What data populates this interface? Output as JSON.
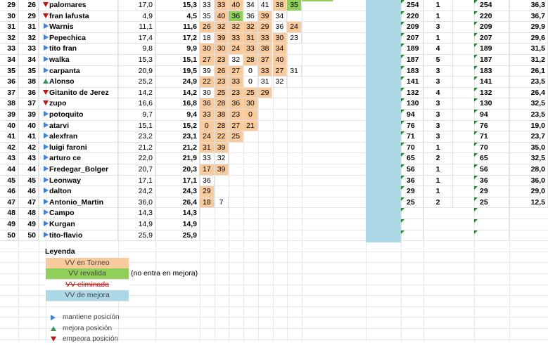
{
  "rows": [
    {
      "a": "29",
      "b": "26",
      "ind": "down",
      "name": "palomares",
      "e": "17,0",
      "f": "15,3",
      "scores": [
        "33",
        "33",
        "40",
        "34",
        "41",
        "38",
        "35"
      ],
      "score_fill": [
        "w",
        "p",
        "p",
        "w",
        "w",
        "p",
        "g"
      ],
      "rank": "254",
      "games": "1",
      "pts": "254",
      "avg": "36,3"
    },
    {
      "a": "30",
      "b": "29",
      "ind": "down",
      "name": "fran lafusta",
      "e": "4,9",
      "f": "4,5",
      "scores": [
        "35",
        "40",
        "36",
        "36",
        "39",
        "34"
      ],
      "score_fill": [
        "w",
        "p",
        "g",
        "w",
        "p",
        "w"
      ],
      "rank": "220",
      "games": "1",
      "pts": "220",
      "avg": "36,7"
    },
    {
      "a": "31",
      "b": "31",
      "ind": "right",
      "name": "Warnis",
      "e": "11,1",
      "f": "11,6",
      "scores": [
        "26",
        "32",
        "32",
        "32",
        "29",
        "36",
        "24"
      ],
      "score_fill": [
        "p",
        "p",
        "p",
        "p",
        "p",
        "w",
        "p"
      ],
      "rank": "209",
      "games": "3",
      "pts": "209",
      "avg": "29,9"
    },
    {
      "a": "32",
      "b": "32",
      "ind": "right",
      "name": "Pepechica",
      "e": "17,4",
      "f": "17,2",
      "scores": [
        "18",
        "39",
        "33",
        "31",
        "33",
        "30",
        "23"
      ],
      "score_fill": [
        "w",
        "p",
        "p",
        "p",
        "p",
        "p",
        "w"
      ],
      "rank": "207",
      "games": "1",
      "pts": "207",
      "avg": "29,6"
    },
    {
      "a": "33",
      "b": "33",
      "ind": "right",
      "name": "tito fran",
      "e": "9,8",
      "f": "9,9",
      "scores": [
        "30",
        "30",
        "24",
        "33",
        "38",
        "34"
      ],
      "score_fill": [
        "p",
        "p",
        "p",
        "p",
        "p",
        "p"
      ],
      "rank": "189",
      "games": "4",
      "pts": "189",
      "avg": "31,5"
    },
    {
      "a": "34",
      "b": "34",
      "ind": "right",
      "name": "walka",
      "e": "15,3",
      "f": "15,1",
      "scores": [
        "27",
        "23",
        "32",
        "28",
        "37",
        "40"
      ],
      "score_fill": [
        "p",
        "p",
        "w",
        "p",
        "p",
        "p"
      ],
      "rank": "187",
      "games": "5",
      "pts": "187",
      "avg": "31,2"
    },
    {
      "a": "35",
      "b": "35",
      "ind": "right",
      "name": "carpanta",
      "e": "20,9",
      "f": "19,5",
      "scores": [
        "39",
        "26",
        "27",
        "0",
        "33",
        "27",
        "31"
      ],
      "score_fill": [
        "w",
        "p",
        "p",
        "w",
        "p",
        "p",
        "w"
      ],
      "rank": "183",
      "games": "3",
      "pts": "183",
      "avg": "26,1"
    },
    {
      "a": "36",
      "b": "38",
      "ind": "up",
      "name": "Alonso",
      "e": "25,2",
      "f": "24,9",
      "scores": [
        "22",
        "23",
        "33",
        "0",
        "31",
        "32"
      ],
      "score_fill": [
        "p",
        "p",
        "p",
        "w",
        "w",
        "w"
      ],
      "rank": "141",
      "games": "3",
      "pts": "141",
      "avg": "23,5"
    },
    {
      "a": "37",
      "b": "36",
      "ind": "down",
      "name": "Gitanito de Jerez",
      "e": "14,2",
      "f": "14,2",
      "scores": [
        "30",
        "25",
        "23",
        "25",
        "29"
      ],
      "score_fill": [
        "w",
        "p",
        "p",
        "p",
        "p"
      ],
      "rank": "132",
      "games": "4",
      "pts": "132",
      "avg": "26,4"
    },
    {
      "a": "38",
      "b": "37",
      "ind": "down",
      "name": "zupo",
      "e": "16,6",
      "f": "16,8",
      "scores": [
        "36",
        "28",
        "36",
        "30"
      ],
      "score_fill": [
        "p",
        "p",
        "p",
        "p"
      ],
      "rank": "130",
      "games": "3",
      "pts": "130",
      "avg": "32,5"
    },
    {
      "a": "39",
      "b": "39",
      "ind": "right",
      "name": "potoquito",
      "e": "9,7",
      "f": "9,4",
      "scores": [
        "33",
        "38",
        "23",
        "0"
      ],
      "score_fill": [
        "p",
        "p",
        "p",
        "p"
      ],
      "rank": "94",
      "games": "3",
      "pts": "94",
      "avg": "23,5"
    },
    {
      "a": "40",
      "b": "40",
      "ind": "right",
      "name": "atarvi",
      "e": "15,1",
      "f": "15,2",
      "scores": [
        "0",
        "28",
        "27",
        "21"
      ],
      "score_fill": [
        "p",
        "p",
        "p",
        "p"
      ],
      "rank": "76",
      "games": "3",
      "pts": "76",
      "avg": "19,0"
    },
    {
      "a": "41",
      "b": "41",
      "ind": "right",
      "name": "alexfran",
      "e": "23,2",
      "f": "23,1",
      "scores": [
        "24",
        "22",
        "25"
      ],
      "score_fill": [
        "p",
        "p",
        "p"
      ],
      "rank": "71",
      "games": "3",
      "pts": "71",
      "avg": "23,7"
    },
    {
      "a": "42",
      "b": "42",
      "ind": "right",
      "name": "luigi faroni",
      "e": "21,2",
      "f": "21,2",
      "scores": [
        "31",
        "39"
      ],
      "score_fill": [
        "p",
        "p"
      ],
      "rank": "70",
      "games": "1",
      "pts": "70",
      "avg": "35,0"
    },
    {
      "a": "43",
      "b": "43",
      "ind": "right",
      "name": "arturo ce",
      "e": "22,0",
      "f": "21,9",
      "scores": [
        "33",
        "32"
      ],
      "score_fill": [
        "w",
        "w"
      ],
      "rank": "65",
      "games": "2",
      "pts": "65",
      "avg": "32,5"
    },
    {
      "a": "44",
      "b": "44",
      "ind": "right",
      "name": "Fredegar_Bolger",
      "e": "20,7",
      "f": "20,3",
      "scores": [
        "17",
        "39"
      ],
      "score_fill": [
        "p",
        "p"
      ],
      "rank": "56",
      "games": "1",
      "pts": "56",
      "avg": "28,0"
    },
    {
      "a": "45",
      "b": "45",
      "ind": "right",
      "name": "Leonway",
      "e": "17,1",
      "f": "17,1",
      "scores": [
        "36"
      ],
      "score_fill": [
        "w"
      ],
      "rank": "36",
      "games": "1",
      "pts": "36",
      "avg": "36,0"
    },
    {
      "a": "46",
      "b": "46",
      "ind": "right",
      "name": "dalton",
      "e": "24,2",
      "f": "24,3",
      "scores": [
        "29"
      ],
      "score_fill": [
        "p"
      ],
      "rank": "29",
      "games": "1",
      "pts": "29",
      "avg": "29,0"
    },
    {
      "a": "47",
      "b": "47",
      "ind": "right",
      "name": "Antonio_Martin",
      "e": "36,0",
      "f": "26,4",
      "scores": [
        "18",
        "7"
      ],
      "score_fill": [
        "p",
        "w"
      ],
      "rank": "25",
      "games": "2",
      "pts": "25",
      "avg": "12,5"
    },
    {
      "a": "48",
      "b": "48",
      "ind": "right",
      "name": "Campo",
      "e": "14,3",
      "f": "14,3",
      "scores": [],
      "score_fill": [],
      "rank": "",
      "games": "",
      "pts": "",
      "avg": ""
    },
    {
      "a": "49",
      "b": "49",
      "ind": "right",
      "name": "Kurgan",
      "e": "14,9",
      "f": "14,9",
      "scores": [],
      "score_fill": [],
      "rank": "",
      "games": "",
      "pts": "",
      "avg": ""
    },
    {
      "a": "50",
      "b": "50",
      "ind": "right",
      "name": "tito-flavio",
      "e": "25,9",
      "f": "25,9",
      "scores": [],
      "score_fill": [],
      "rank": "",
      "games": "",
      "pts": "",
      "avg": ""
    }
  ],
  "legend": {
    "title": "Leyenda",
    "vv_torneo": "VV en Torneo",
    "vv_revalida": "VV revalida",
    "vv_revalida_note": "(no entra en mejora)",
    "vv_eliminada": "VV eliminada",
    "vv_mejora": "VV de mejora",
    "mantiene": "mantiene posición",
    "mejora": "mejora posición",
    "empeora": "empeora posición"
  },
  "colors": {
    "peach": "#f9cb9c",
    "green": "#8fcf5a",
    "blue": "#add8e6",
    "arrow_right": "#3f7fe0",
    "arrow_up": "#3a9a5b",
    "arrow_down": "#cc1111"
  }
}
